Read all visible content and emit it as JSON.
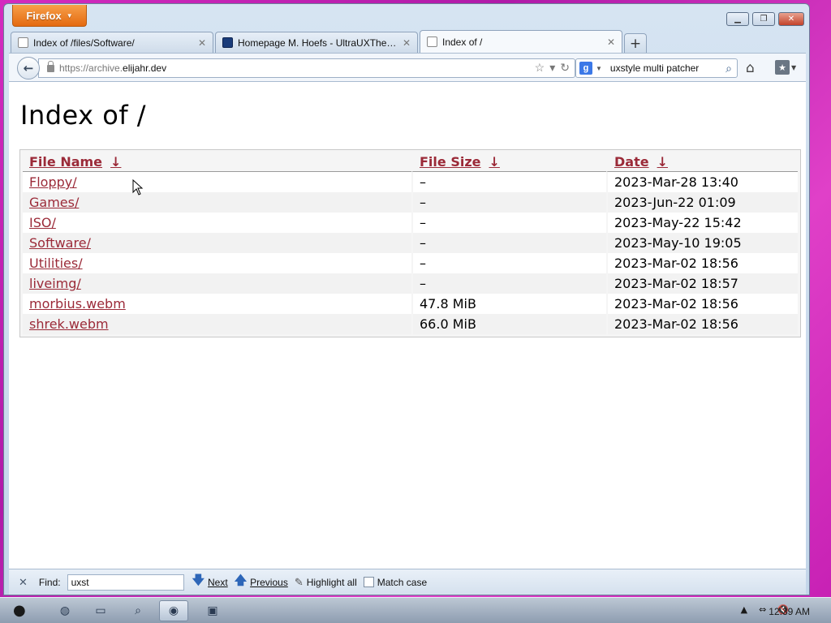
{
  "browser": {
    "app_button_label": "Firefox",
    "tabs": [
      {
        "label": "Index of /files/Software/",
        "active": false
      },
      {
        "label": "Homepage M. Hoefs - UltraUXTheme...",
        "active": false
      },
      {
        "label": "Index of /",
        "active": true
      }
    ],
    "url_prefix": "https://archive.",
    "url_host": "elijahr.dev",
    "search_value": "uxstyle multi patcher"
  },
  "page": {
    "title": "Index of /",
    "columns": [
      {
        "label": "File Name",
        "arrow": "↓"
      },
      {
        "label": "File Size",
        "arrow": "↓"
      },
      {
        "label": "Date",
        "arrow": "↓"
      }
    ],
    "rows": [
      {
        "name": "Floppy/",
        "size": "–",
        "date": "2023-Mar-28 13:40"
      },
      {
        "name": "Games/",
        "size": "–",
        "date": "2023-Jun-22 01:09"
      },
      {
        "name": "ISO/",
        "size": "–",
        "date": "2023-May-22 15:42"
      },
      {
        "name": "Software/",
        "size": "–",
        "date": "2023-May-10 19:05"
      },
      {
        "name": "Utilities/",
        "size": "–",
        "date": "2023-Mar-02 18:56"
      },
      {
        "name": "liveimg/",
        "size": "–",
        "date": "2023-Mar-02 18:57"
      },
      {
        "name": "morbius.webm",
        "size": "47.8 MiB",
        "date": "2023-Mar-02 18:56"
      },
      {
        "name": "shrek.webm",
        "size": "66.0 MiB",
        "date": "2023-Mar-02 18:56"
      }
    ]
  },
  "findbar": {
    "label": "Find:",
    "value": "uxst",
    "next_label": "Next",
    "previous_label": "Previous",
    "highlight_label": "Highlight all",
    "match_case_label": "Match case"
  },
  "taskbar": {
    "clock": "12:39 AM"
  },
  "colors": {
    "link": "#9b2a38",
    "firefox_orange": "#e46a10",
    "desktop": "#c61fb3"
  }
}
